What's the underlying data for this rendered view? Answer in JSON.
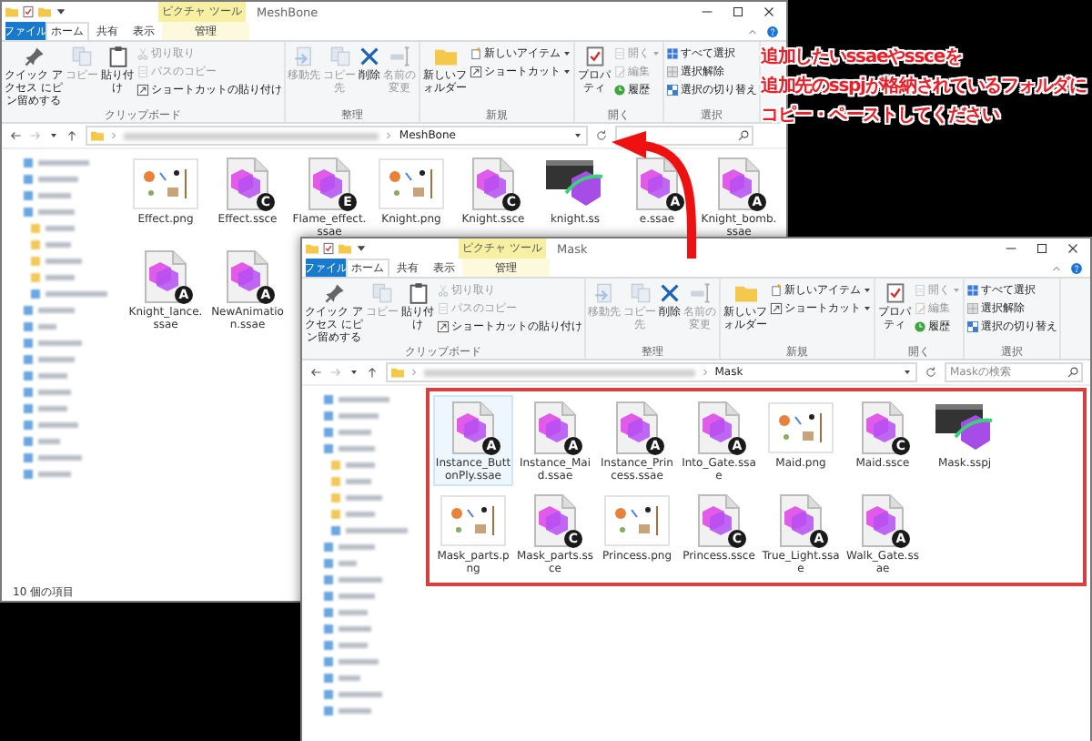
{
  "windows": [
    {
      "title": "MeshBone",
      "tool_header": "ピクチャ ツール",
      "tabs": [
        {
          "label": "ファイル",
          "kind": "file",
          "selected": false
        },
        {
          "label": "ホーム",
          "kind": "plain",
          "selected": true
        },
        {
          "label": "共有",
          "kind": "plain",
          "selected": false
        },
        {
          "label": "表示",
          "kind": "plain",
          "selected": false
        },
        {
          "label": "管理",
          "kind": "tool",
          "selected": false
        }
      ],
      "ribbon_groups": [
        {
          "label": "クリップボード",
          "items": [
            {
              "label": "クイック アクセス にピン留めする",
              "kind": "large",
              "disabled": false
            },
            {
              "label": "コピー",
              "kind": "large",
              "disabled": true
            },
            {
              "label": "貼り付け",
              "kind": "large",
              "disabled": false
            },
            {
              "label": "切り取り",
              "kind": "small",
              "disabled": true
            },
            {
              "label": "パスのコピー",
              "kind": "small",
              "disabled": true
            },
            {
              "label": "ショートカットの貼り付け",
              "kind": "small",
              "disabled": false
            }
          ]
        },
        {
          "label": "整理",
          "items": [
            {
              "label": "移動先",
              "kind": "large",
              "disabled": true
            },
            {
              "label": "コピー先",
              "kind": "large",
              "disabled": true
            },
            {
              "label": "削除",
              "kind": "large",
              "disabled": false
            },
            {
              "label": "名前の変更",
              "kind": "large",
              "disabled": true
            }
          ]
        },
        {
          "label": "新規",
          "items": [
            {
              "label": "新しいフォルダー",
              "kind": "large",
              "disabled": false
            },
            {
              "label": "新しいアイテム",
              "kind": "small",
              "disabled": false
            },
            {
              "label": "ショートカット",
              "kind": "small",
              "disabled": false
            }
          ]
        },
        {
          "label": "開く",
          "items": [
            {
              "label": "プロパティ",
              "kind": "large",
              "disabled": false
            },
            {
              "label": "開く",
              "kind": "small",
              "disabled": true
            },
            {
              "label": "編集",
              "kind": "small",
              "disabled": true
            },
            {
              "label": "履歴",
              "kind": "small",
              "disabled": false
            }
          ]
        },
        {
          "label": "選択",
          "items": [
            {
              "label": "すべて選択",
              "kind": "small",
              "disabled": false
            },
            {
              "label": "選択解除",
              "kind": "small",
              "disabled": false
            },
            {
              "label": "選択の切り替え",
              "kind": "small",
              "disabled": false
            }
          ]
        }
      ],
      "address": {
        "folder": "MeshBone"
      },
      "files": [
        {
          "name": "Effect.png",
          "kind": "image",
          "selected": false
        },
        {
          "name": "Effect.ssce",
          "kind": "doc",
          "badge": "C",
          "selected": false
        },
        {
          "name": "Flame_effect.ssae",
          "kind": "doc",
          "badge": "E",
          "selected": false
        },
        {
          "name": "Knight.png",
          "kind": "image",
          "selected": false
        },
        {
          "name": "Knight.ssce",
          "kind": "doc",
          "badge": "C",
          "selected": false
        },
        {
          "name": "knight.ss",
          "kind": "project",
          "selected": false
        },
        {
          "name": "e.ssae",
          "kind": "doc",
          "badge": "A",
          "selected": false
        },
        {
          "name": "Knight_bomb.ssae",
          "kind": "doc",
          "badge": "A",
          "selected": false
        },
        {
          "name": "Knight_lance.ssae",
          "kind": "doc",
          "badge": "A",
          "selected": false
        },
        {
          "name": "NewAnimation.ssae",
          "kind": "doc",
          "badge": "A",
          "selected": false
        }
      ],
      "status": "10 個の項目",
      "highlighted": false
    },
    {
      "title": "Mask",
      "tool_header": "ピクチャ ツール",
      "tabs": [
        {
          "label": "ファイル",
          "kind": "file",
          "selected": false
        },
        {
          "label": "ホーム",
          "kind": "plain",
          "selected": true
        },
        {
          "label": "共有",
          "kind": "plain",
          "selected": false
        },
        {
          "label": "表示",
          "kind": "plain",
          "selected": false
        },
        {
          "label": "管理",
          "kind": "tool",
          "selected": false
        }
      ],
      "ribbon_groups": [
        {
          "label": "クリップボード",
          "items": [
            {
              "label": "クイック アクセス にピン留めする",
              "kind": "large",
              "disabled": false
            },
            {
              "label": "コピー",
              "kind": "large",
              "disabled": true
            },
            {
              "label": "貼り付け",
              "kind": "large",
              "disabled": false
            },
            {
              "label": "切り取り",
              "kind": "small",
              "disabled": true
            },
            {
              "label": "パスのコピー",
              "kind": "small",
              "disabled": true
            },
            {
              "label": "ショートカットの貼り付け",
              "kind": "small",
              "disabled": false
            }
          ]
        },
        {
          "label": "整理",
          "items": [
            {
              "label": "移動先",
              "kind": "large",
              "disabled": true
            },
            {
              "label": "コピー先",
              "kind": "large",
              "disabled": true
            },
            {
              "label": "削除",
              "kind": "large",
              "disabled": false
            },
            {
              "label": "名前の変更",
              "kind": "large",
              "disabled": true
            }
          ]
        },
        {
          "label": "新規",
          "items": [
            {
              "label": "新しいフォルダー",
              "kind": "large",
              "disabled": false
            },
            {
              "label": "新しいアイテム",
              "kind": "small",
              "disabled": false
            },
            {
              "label": "ショートカット",
              "kind": "small",
              "disabled": false
            }
          ]
        },
        {
          "label": "開く",
          "items": [
            {
              "label": "プロパティ",
              "kind": "large",
              "disabled": false
            },
            {
              "label": "開く",
              "kind": "small",
              "disabled": true
            },
            {
              "label": "編集",
              "kind": "small",
              "disabled": true
            },
            {
              "label": "履歴",
              "kind": "small",
              "disabled": false
            }
          ]
        },
        {
          "label": "選択",
          "items": [
            {
              "label": "すべて選択",
              "kind": "small",
              "disabled": false
            },
            {
              "label": "選択解除",
              "kind": "small",
              "disabled": false
            },
            {
              "label": "選択の切り替え",
              "kind": "small",
              "disabled": false
            }
          ]
        }
      ],
      "address": {
        "folder": "Mask"
      },
      "search": {
        "placeholder": "Maskの検索"
      },
      "files": [
        {
          "name": "Instance_ButtonPly.ssae",
          "kind": "doc",
          "badge": "A",
          "selected": true
        },
        {
          "name": "Instance_Maid.ssae",
          "kind": "doc",
          "badge": "A",
          "selected": false
        },
        {
          "name": "Instance_Princess.ssae",
          "kind": "doc",
          "badge": "A",
          "selected": false
        },
        {
          "name": "Into_Gate.ssae",
          "kind": "doc",
          "badge": "A",
          "selected": false
        },
        {
          "name": "Maid.png",
          "kind": "image",
          "selected": false
        },
        {
          "name": "Maid.ssce",
          "kind": "doc",
          "badge": "C",
          "selected": false
        },
        {
          "name": "Mask.sspj",
          "kind": "project",
          "selected": false
        },
        {
          "name": "Mask_parts.png",
          "kind": "image",
          "selected": false
        },
        {
          "name": "Mask_parts.ssce",
          "kind": "doc",
          "badge": "C",
          "selected": false
        },
        {
          "name": "Princess.png",
          "kind": "image",
          "selected": false
        },
        {
          "name": "Princess.ssce",
          "kind": "doc",
          "badge": "C",
          "selected": false
        },
        {
          "name": "True_Light.ssae",
          "kind": "doc",
          "badge": "A",
          "selected": false
        },
        {
          "name": "Walk_Gate.ssae",
          "kind": "doc",
          "badge": "A",
          "selected": false
        }
      ],
      "highlighted": true
    }
  ],
  "annotation": {
    "lines": [
      "追加したいssaeやssceを",
      "追加先のsspjが格納されているフォルダに",
      "コピー・ペーストしてください"
    ]
  }
}
